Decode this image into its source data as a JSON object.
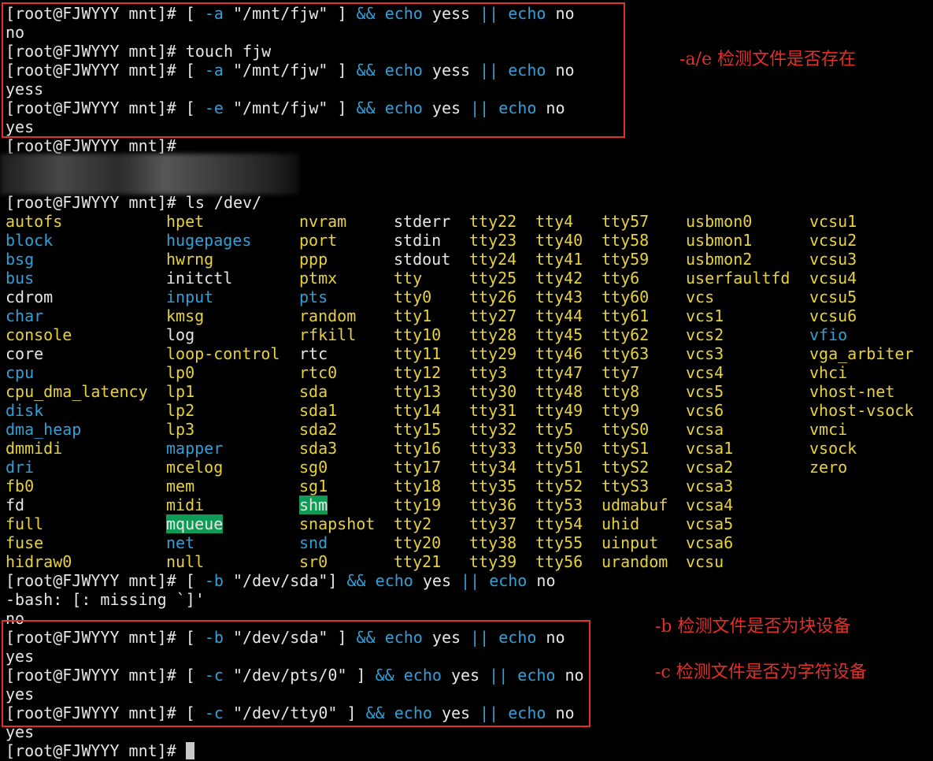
{
  "prompt": "[root@FJWYYY mnt]# ",
  "colors": {
    "keyword": "#2fa0d8",
    "device": "#e8d23c",
    "highlight": "#0f9b55",
    "annotation": "#e0302a"
  },
  "top_lines": [
    {
      "out": "no"
    },
    {
      "cmd_plain": "touch fjw"
    },
    {
      "out": "yess"
    },
    {
      "out": "yes"
    }
  ],
  "cmd1": {
    "a": "[ ",
    "b": "-a",
    "c": " \"/mnt/fjw\" ] ",
    "d": "&&",
    "e": " ",
    "f": "echo",
    "g": " yess ",
    "h": "||",
    "i": " ",
    "j": "echo",
    "k": " no"
  },
  "cmd2": {
    "a": "[ ",
    "b": "-a",
    "c": " \"/mnt/fjw\" ] ",
    "d": "&&",
    "e": " ",
    "f": "echo",
    "g": " yess ",
    "h": "||",
    "i": " ",
    "j": "echo",
    "k": " no"
  },
  "cmd3": {
    "a": "[ ",
    "b": "-e",
    "c": " \"/mnt/fjw\" ] ",
    "d": "&&",
    "e": " ",
    "f": "echo",
    "g": " yes ",
    "h": "||",
    "i": " ",
    "j": "echo",
    "k": " no"
  },
  "ls_cmd": "ls /dev/",
  "cmd4": {
    "a": "[ ",
    "b": "-b",
    "c": " \"/dev/sda\"] ",
    "d": "&&",
    "e": " ",
    "f": "echo",
    "g": " yes ",
    "h": "||",
    "i": " ",
    "j": "echo",
    "k": " no"
  },
  "bash_error": "-bash: [: missing `]'",
  "cmd5": {
    "a": "[ ",
    "b": "-b",
    "c": " \"/dev/sda\" ] ",
    "d": "&&",
    "e": " ",
    "f": "echo",
    "g": " yes ",
    "h": "||",
    "i": " ",
    "j": "echo",
    "k": " no"
  },
  "cmd6": {
    "a": "[ ",
    "b": "-c",
    "c": " \"/dev/pts/0\" ] ",
    "d": "&&",
    "e": " ",
    "f": "echo",
    "g": " yes ",
    "h": "||",
    "i": " ",
    "j": "echo",
    "k": " no"
  },
  "cmd7": {
    "a": "[ ",
    "b": "-c",
    "c": " \"/dev/tty0\" ] ",
    "d": "&&",
    "e": " ",
    "f": "echo",
    "g": " yes ",
    "h": "||",
    "i": " ",
    "j": "echo",
    "k": " no"
  },
  "out_no": "no",
  "out_yes": "yes",
  "annotations": {
    "ae": "-a/e 检测文件是否存在",
    "b": "-b 检测文件是否为块设备",
    "c": "-c 检测文件是否为字符设备"
  },
  "dev_listing": [
    [
      {
        "n": "autofs",
        "t": "dev"
      },
      {
        "n": "block",
        "t": "dir"
      },
      {
        "n": "bsg",
        "t": "dir"
      },
      {
        "n": "bus",
        "t": "dir"
      },
      {
        "n": "cdrom",
        "t": "file"
      },
      {
        "n": "char",
        "t": "dir"
      },
      {
        "n": "console",
        "t": "dev"
      },
      {
        "n": "core",
        "t": "file"
      },
      {
        "n": "cpu",
        "t": "dir"
      },
      {
        "n": "cpu_dma_latency",
        "t": "dev"
      },
      {
        "n": "disk",
        "t": "dir"
      },
      {
        "n": "dma_heap",
        "t": "dir"
      },
      {
        "n": "dmmidi",
        "t": "dev"
      },
      {
        "n": "dri",
        "t": "dir"
      },
      {
        "n": "fb0",
        "t": "dev"
      },
      {
        "n": "fd",
        "t": "file"
      },
      {
        "n": "full",
        "t": "dev"
      },
      {
        "n": "fuse",
        "t": "dev"
      },
      {
        "n": "hidraw0",
        "t": "dev"
      }
    ],
    [
      {
        "n": "hpet",
        "t": "dev"
      },
      {
        "n": "hugepages",
        "t": "dir"
      },
      {
        "n": "hwrng",
        "t": "dev"
      },
      {
        "n": "initctl",
        "t": "file"
      },
      {
        "n": "input",
        "t": "dir"
      },
      {
        "n": "kmsg",
        "t": "dev"
      },
      {
        "n": "log",
        "t": "file"
      },
      {
        "n": "loop-control",
        "t": "dev"
      },
      {
        "n": "lp0",
        "t": "dev"
      },
      {
        "n": "lp1",
        "t": "dev"
      },
      {
        "n": "lp2",
        "t": "dev"
      },
      {
        "n": "lp3",
        "t": "dev"
      },
      {
        "n": "mapper",
        "t": "dir"
      },
      {
        "n": "mcelog",
        "t": "dev"
      },
      {
        "n": "mem",
        "t": "dev"
      },
      {
        "n": "midi",
        "t": "dev"
      },
      {
        "n": "mqueue",
        "t": "hl"
      },
      {
        "n": "net",
        "t": "dir"
      },
      {
        "n": "null",
        "t": "dev"
      }
    ],
    [
      {
        "n": "nvram",
        "t": "dev"
      },
      {
        "n": "port",
        "t": "dev"
      },
      {
        "n": "ppp",
        "t": "dev"
      },
      {
        "n": "ptmx",
        "t": "dev"
      },
      {
        "n": "pts",
        "t": "dir"
      },
      {
        "n": "random",
        "t": "dev"
      },
      {
        "n": "rfkill",
        "t": "dev"
      },
      {
        "n": "rtc",
        "t": "file"
      },
      {
        "n": "rtc0",
        "t": "dev"
      },
      {
        "n": "sda",
        "t": "dev"
      },
      {
        "n": "sda1",
        "t": "dev"
      },
      {
        "n": "sda2",
        "t": "dev"
      },
      {
        "n": "sda3",
        "t": "dev"
      },
      {
        "n": "sg0",
        "t": "dev"
      },
      {
        "n": "sg1",
        "t": "dev"
      },
      {
        "n": "shm",
        "t": "hl"
      },
      {
        "n": "snapshot",
        "t": "dev"
      },
      {
        "n": "snd",
        "t": "dir"
      },
      {
        "n": "sr0",
        "t": "dev"
      }
    ],
    [
      {
        "n": "stderr",
        "t": "file"
      },
      {
        "n": "stdin",
        "t": "file"
      },
      {
        "n": "stdout",
        "t": "file"
      },
      {
        "n": "tty",
        "t": "dev"
      },
      {
        "n": "tty0",
        "t": "dev"
      },
      {
        "n": "tty1",
        "t": "dev"
      },
      {
        "n": "tty10",
        "t": "dev"
      },
      {
        "n": "tty11",
        "t": "dev"
      },
      {
        "n": "tty12",
        "t": "dev"
      },
      {
        "n": "tty13",
        "t": "dev"
      },
      {
        "n": "tty14",
        "t": "dev"
      },
      {
        "n": "tty15",
        "t": "dev"
      },
      {
        "n": "tty16",
        "t": "dev"
      },
      {
        "n": "tty17",
        "t": "dev"
      },
      {
        "n": "tty18",
        "t": "dev"
      },
      {
        "n": "tty19",
        "t": "dev"
      },
      {
        "n": "tty2",
        "t": "dev"
      },
      {
        "n": "tty20",
        "t": "dev"
      },
      {
        "n": "tty21",
        "t": "dev"
      }
    ],
    [
      {
        "n": "tty22",
        "t": "dev"
      },
      {
        "n": "tty23",
        "t": "dev"
      },
      {
        "n": "tty24",
        "t": "dev"
      },
      {
        "n": "tty25",
        "t": "dev"
      },
      {
        "n": "tty26",
        "t": "dev"
      },
      {
        "n": "tty27",
        "t": "dev"
      },
      {
        "n": "tty28",
        "t": "dev"
      },
      {
        "n": "tty29",
        "t": "dev"
      },
      {
        "n": "tty3",
        "t": "dev"
      },
      {
        "n": "tty30",
        "t": "dev"
      },
      {
        "n": "tty31",
        "t": "dev"
      },
      {
        "n": "tty32",
        "t": "dev"
      },
      {
        "n": "tty33",
        "t": "dev"
      },
      {
        "n": "tty34",
        "t": "dev"
      },
      {
        "n": "tty35",
        "t": "dev"
      },
      {
        "n": "tty36",
        "t": "dev"
      },
      {
        "n": "tty37",
        "t": "dev"
      },
      {
        "n": "tty38",
        "t": "dev"
      },
      {
        "n": "tty39",
        "t": "dev"
      }
    ],
    [
      {
        "n": "tty4",
        "t": "dev"
      },
      {
        "n": "tty40",
        "t": "dev"
      },
      {
        "n": "tty41",
        "t": "dev"
      },
      {
        "n": "tty42",
        "t": "dev"
      },
      {
        "n": "tty43",
        "t": "dev"
      },
      {
        "n": "tty44",
        "t": "dev"
      },
      {
        "n": "tty45",
        "t": "dev"
      },
      {
        "n": "tty46",
        "t": "dev"
      },
      {
        "n": "tty47",
        "t": "dev"
      },
      {
        "n": "tty48",
        "t": "dev"
      },
      {
        "n": "tty49",
        "t": "dev"
      },
      {
        "n": "tty5",
        "t": "dev"
      },
      {
        "n": "tty50",
        "t": "dev"
      },
      {
        "n": "tty51",
        "t": "dev"
      },
      {
        "n": "tty52",
        "t": "dev"
      },
      {
        "n": "tty53",
        "t": "dev"
      },
      {
        "n": "tty54",
        "t": "dev"
      },
      {
        "n": "tty55",
        "t": "dev"
      },
      {
        "n": "tty56",
        "t": "dev"
      }
    ],
    [
      {
        "n": "tty57",
        "t": "dev"
      },
      {
        "n": "tty58",
        "t": "dev"
      },
      {
        "n": "tty59",
        "t": "dev"
      },
      {
        "n": "tty6",
        "t": "dev"
      },
      {
        "n": "tty60",
        "t": "dev"
      },
      {
        "n": "tty61",
        "t": "dev"
      },
      {
        "n": "tty62",
        "t": "dev"
      },
      {
        "n": "tty63",
        "t": "dev"
      },
      {
        "n": "tty7",
        "t": "dev"
      },
      {
        "n": "tty8",
        "t": "dev"
      },
      {
        "n": "tty9",
        "t": "dev"
      },
      {
        "n": "ttyS0",
        "t": "dev"
      },
      {
        "n": "ttyS1",
        "t": "dev"
      },
      {
        "n": "ttyS2",
        "t": "dev"
      },
      {
        "n": "ttyS3",
        "t": "dev"
      },
      {
        "n": "udmabuf",
        "t": "dev"
      },
      {
        "n": "uhid",
        "t": "dev"
      },
      {
        "n": "uinput",
        "t": "dev"
      },
      {
        "n": "urandom",
        "t": "dev"
      }
    ],
    [
      {
        "n": "usbmon0",
        "t": "dev"
      },
      {
        "n": "usbmon1",
        "t": "dev"
      },
      {
        "n": "usbmon2",
        "t": "dev"
      },
      {
        "n": "userfaultfd",
        "t": "dev"
      },
      {
        "n": "vcs",
        "t": "dev"
      },
      {
        "n": "vcs1",
        "t": "dev"
      },
      {
        "n": "vcs2",
        "t": "dev"
      },
      {
        "n": "vcs3",
        "t": "dev"
      },
      {
        "n": "vcs4",
        "t": "dev"
      },
      {
        "n": "vcs5",
        "t": "dev"
      },
      {
        "n": "vcs6",
        "t": "dev"
      },
      {
        "n": "vcsa",
        "t": "dev"
      },
      {
        "n": "vcsa1",
        "t": "dev"
      },
      {
        "n": "vcsa2",
        "t": "dev"
      },
      {
        "n": "vcsa3",
        "t": "dev"
      },
      {
        "n": "vcsa4",
        "t": "dev"
      },
      {
        "n": "vcsa5",
        "t": "dev"
      },
      {
        "n": "vcsa6",
        "t": "dev"
      },
      {
        "n": "vcsu",
        "t": "dev"
      }
    ],
    [
      {
        "n": "vcsu1",
        "t": "dev"
      },
      {
        "n": "vcsu2",
        "t": "dev"
      },
      {
        "n": "vcsu3",
        "t": "dev"
      },
      {
        "n": "vcsu4",
        "t": "dev"
      },
      {
        "n": "vcsu5",
        "t": "dev"
      },
      {
        "n": "vcsu6",
        "t": "dev"
      },
      {
        "n": "vfio",
        "t": "dir"
      },
      {
        "n": "vga_arbiter",
        "t": "dev"
      },
      {
        "n": "vhci",
        "t": "dev"
      },
      {
        "n": "vhost-net",
        "t": "dev"
      },
      {
        "n": "vhost-vsock",
        "t": "dev"
      },
      {
        "n": "vmci",
        "t": "dev"
      },
      {
        "n": "vsock",
        "t": "dev"
      },
      {
        "n": "zero",
        "t": "dev"
      }
    ]
  ]
}
